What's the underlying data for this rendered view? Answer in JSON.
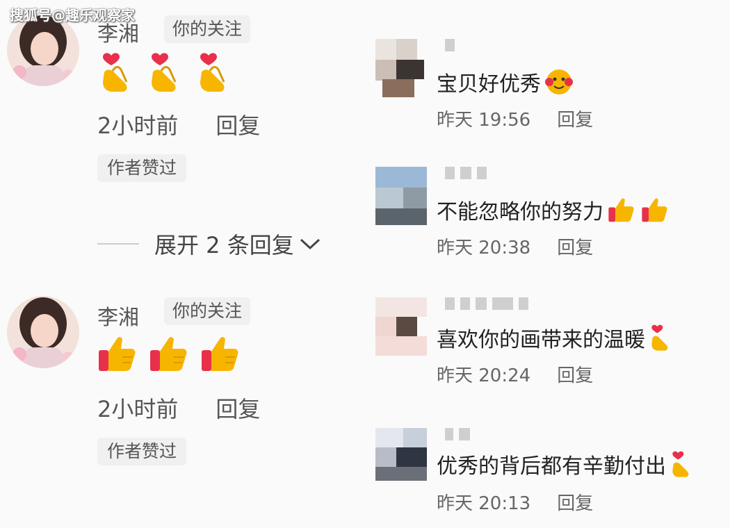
{
  "watermark": "搜狐号@趣乐观察家",
  "comments": [
    {
      "name": "李湘",
      "tag": "你的关注",
      "time": "2小时前",
      "reply": "回复",
      "liked": "作者赞过",
      "emoji": "heart-hands-emoji"
    },
    {
      "name": "李湘",
      "tag": "你的关注",
      "time": "2小时前",
      "reply": "回复",
      "liked": "作者赞过",
      "emoji": "thumbs-up-emoji"
    }
  ],
  "expand_replies": "展开 2 条回复",
  "right_comments": [
    {
      "text": "宝贝好优秀",
      "time": "昨天 19:56",
      "reply": "回复"
    },
    {
      "text": "不能忽略你的努力",
      "time": "昨天 20:38",
      "reply": "回复"
    },
    {
      "text": "喜欢你的画带来的温暖",
      "time": "昨天 20:24",
      "reply": "回复"
    },
    {
      "text": "优秀的背后都有辛勤付出",
      "time": "昨天 20:13",
      "reply": "回复"
    }
  ],
  "colors": {
    "background": "#fafafa",
    "tag_bg": "#f0f0f0",
    "thumb": "#f7b500",
    "heart": "#e8304b"
  }
}
